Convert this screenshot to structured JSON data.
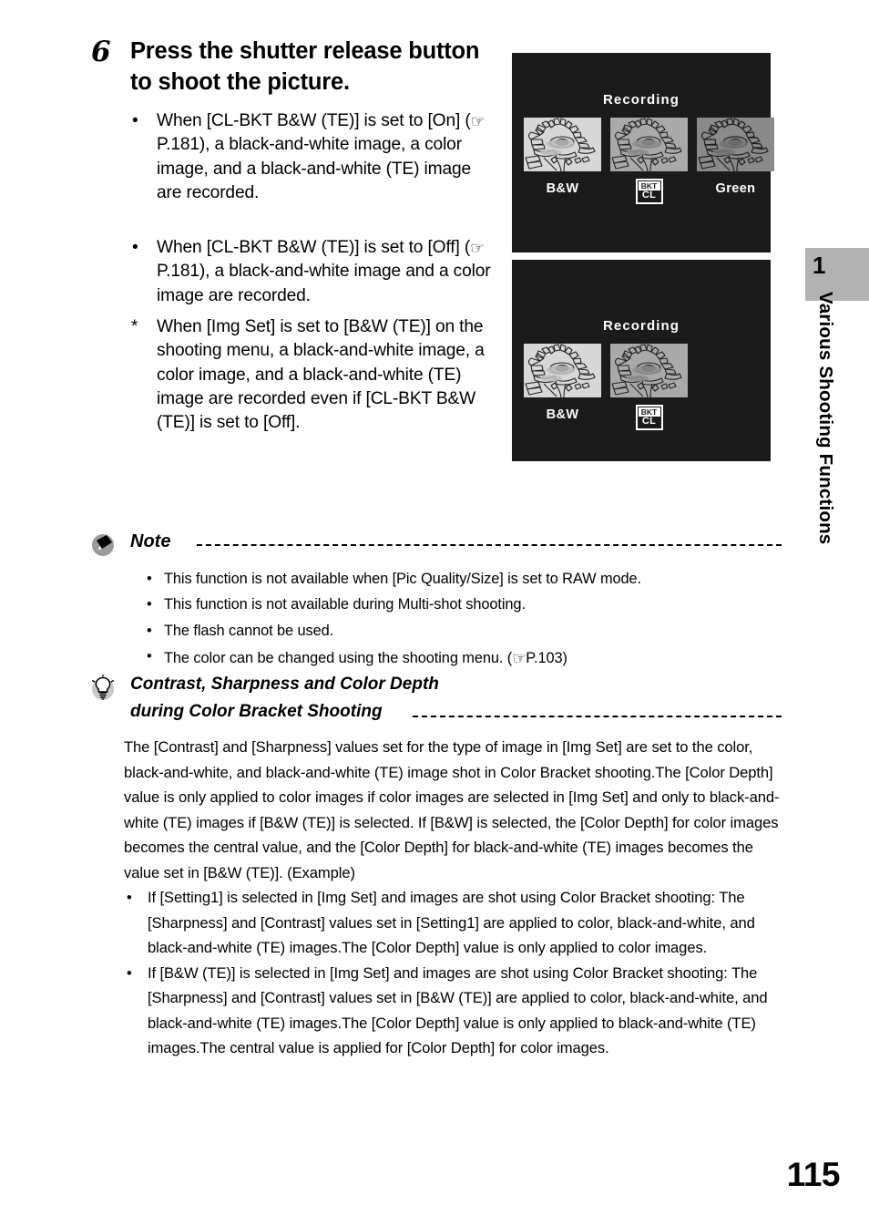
{
  "page": {
    "number": "115"
  },
  "chapter": {
    "number": "1",
    "title": "Various Shooting Functions"
  },
  "step": {
    "number": "6",
    "heading": "Press the shutter release button to shoot the picture.",
    "bullets": [
      {
        "marker": "•",
        "text_before": "When [CL-BKT B&W (TE)] is set to [On] (",
        "hand_icon": "pointing-hand-icon",
        "hand_glyph": "☞",
        "reference": "P.181",
        "text_after": "), a black-and-white image, a color image, and a black-and-white (TE) image are recorded."
      },
      {
        "marker": "•",
        "text_before": "When [CL-BKT B&W (TE)] is set to [Off] (",
        "hand_icon": "pointing-hand-icon",
        "hand_glyph": "☞",
        "reference": "P.181",
        "text_after": "), a black-and-white image and a color image are recorded."
      },
      {
        "marker": "*",
        "text_before": "When [Img Set] is set to [B&W (TE)] on the shooting menu, a black-and-white image, a color image, and a black-and-white (TE) image are recorded even if [CL-BKT B&W (TE)] is set to [Off].",
        "hand_glyph": "",
        "reference": "",
        "text_after": ""
      }
    ]
  },
  "screens": [
    {
      "name": "lcd-screen-three-shot",
      "title": "Recording",
      "thumbnails": [
        {
          "label": "B&W",
          "tone": "tone-light",
          "badge": null
        },
        {
          "label": "",
          "tone": "tone-mid",
          "badge": {
            "top": "BKT",
            "bottom": "CL"
          }
        },
        {
          "label": "Green",
          "tone": "tone-dark",
          "badge": null
        }
      ]
    },
    {
      "name": "lcd-screen-two-shot",
      "title": "Recording",
      "thumbnails": [
        {
          "label": "B&W",
          "tone": "tone-light",
          "badge": null
        },
        {
          "label": "",
          "tone": "tone-mid",
          "badge": {
            "top": "BKT",
            "bottom": "CL"
          }
        }
      ]
    }
  ],
  "note": {
    "icon": "note-icon",
    "title": "Note",
    "items": [
      {
        "marker": "•",
        "text": "This function is not available when [Pic Quality/Size] is set to RAW mode."
      },
      {
        "marker": "•",
        "text": "This function is not available during Multi-shot shooting."
      },
      {
        "marker": "•",
        "text": "The flash cannot be used."
      },
      {
        "marker": "•",
        "text_before": "The color can be changed using the shooting menu. (",
        "hand_glyph": "☞",
        "reference": "P.103",
        "text_after": ")"
      }
    ]
  },
  "tip": {
    "icon": "lightbulb-icon",
    "title_line1": "Contrast, Sharpness and Color Depth",
    "title_line2": "during Color Bracket Shooting",
    "paragraph": "The [Contrast] and [Sharpness] values set for the type of image in [Img Set] are set to the color, black-and-white, and black-and-white (TE) image shot in Color Bracket shooting.The [Color Depth] value is only applied to color images if color images are selected in [Img Set] and only to black-and-white (TE) images if [B&W (TE)] is selected. If [B&W] is selected, the [Color Depth] for color images becomes the central value, and the [Color Depth] for black-and-white (TE) images becomes the value set in [B&W (TE)]. (Example)",
    "bullets": [
      {
        "marker": "•",
        "text": "If [Setting1] is selected in [Img Set] and images are shot using Color Bracket shooting: The [Sharpness] and [Contrast] values set in [Setting1] are applied to color, black-and-white, and black-and-white (TE) images.The [Color Depth] value is only applied to color images."
      },
      {
        "marker": "•",
        "text": "If [B&W (TE)] is selected in [Img Set] and images are shot using Color Bracket shooting: The [Sharpness] and [Contrast] values set in [B&W (TE)] are applied to color, black-and-white, and black-and-white (TE) images.The [Color Depth] value is only applied to black-and-white (TE) images.The central value is applied for [Color Depth] for color images."
      }
    ]
  },
  "colors": {
    "chapter_tab_bg": "#b2b2b2",
    "lcd_bg": "#1b1b1b",
    "thumb_light": "#d7d7d7",
    "thumb_mid": "#a9a9a9",
    "thumb_dark": "#8a8a8a",
    "text": "#000000"
  }
}
